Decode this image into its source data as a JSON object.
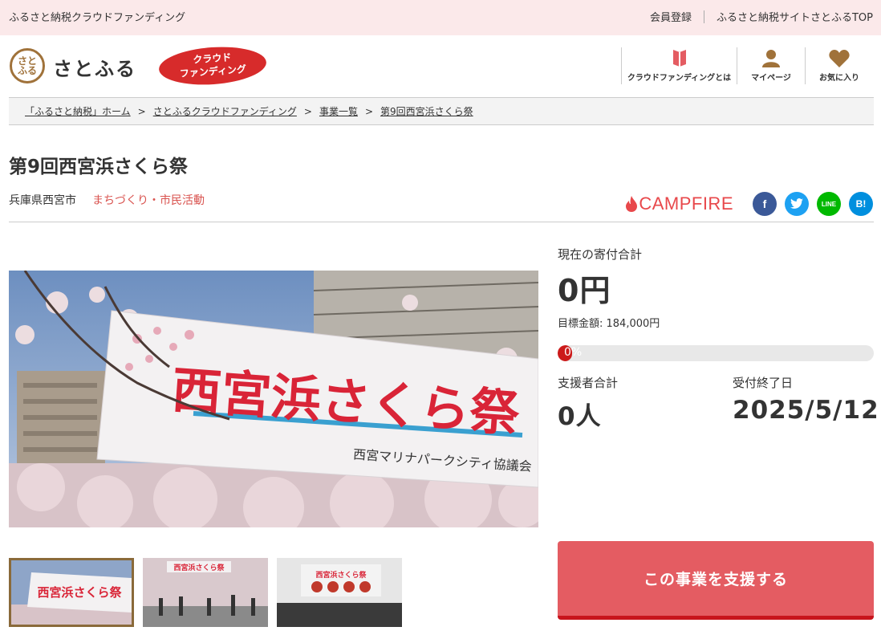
{
  "topbar": {
    "site_title": "ふるさと納税クラウドファンディング",
    "register_label": "会員登録",
    "satofull_top_label": "ふるさと納税サイトさとふるTOP"
  },
  "header": {
    "logo_mark": "さと\nふる",
    "logo_text": "さとふる",
    "badge_line1": "クラウド",
    "badge_line2": "ファンディング",
    "nav": [
      {
        "label": "クラウドファンディングとは",
        "icon": "book-icon"
      },
      {
        "label": "マイページ",
        "icon": "user-icon"
      },
      {
        "label": "お気に入り",
        "icon": "heart-icon"
      }
    ]
  },
  "breadcrumb": [
    "「ふるさと納税」ホーム",
    "さとふるクラウドファンディング",
    "事業一覧",
    "第9回西宮浜さくら祭"
  ],
  "project": {
    "title": "第9回西宮浜さくら祭",
    "location": "兵庫県西宮市",
    "category": "まちづくり・市民活動"
  },
  "share": {
    "campfire_label": "CAMPFIRE",
    "buttons": [
      {
        "name": "facebook",
        "glyph": "f",
        "color": "#3b5998"
      },
      {
        "name": "twitter",
        "glyph": "t",
        "color": "#1da1f2"
      },
      {
        "name": "line",
        "glyph": "LINE",
        "color": "#00b900"
      },
      {
        "name": "hatena",
        "glyph": "B!",
        "color": "#008fde"
      }
    ]
  },
  "images": {
    "banner_text": "西宮浜さくら祭",
    "banner_sub": "西宮マリナパークシティ協議会",
    "thumb1_text": "西宮浜さくら祭",
    "thumb2_text": "西宮浜さくら祭",
    "thumb3_text": "西宮浜さくら祭"
  },
  "stats": {
    "current_label": "現在の寄付合計",
    "current_amount": "0円",
    "goal_text": "目標金額: 184,000円",
    "progress_pct_text": "0%",
    "progress_fraction": 0.0,
    "supporters_label": "支援者合計",
    "supporters_value": "0人",
    "deadline_label": "受付終了日",
    "deadline_value": "2025/5/12"
  },
  "cta": {
    "support_label": "この事業を支援する"
  },
  "colors": {
    "accent": "#e45c62",
    "topbar_bg": "#fbe9ea",
    "category": "#d9534f",
    "progress": "#cc1a1a"
  }
}
